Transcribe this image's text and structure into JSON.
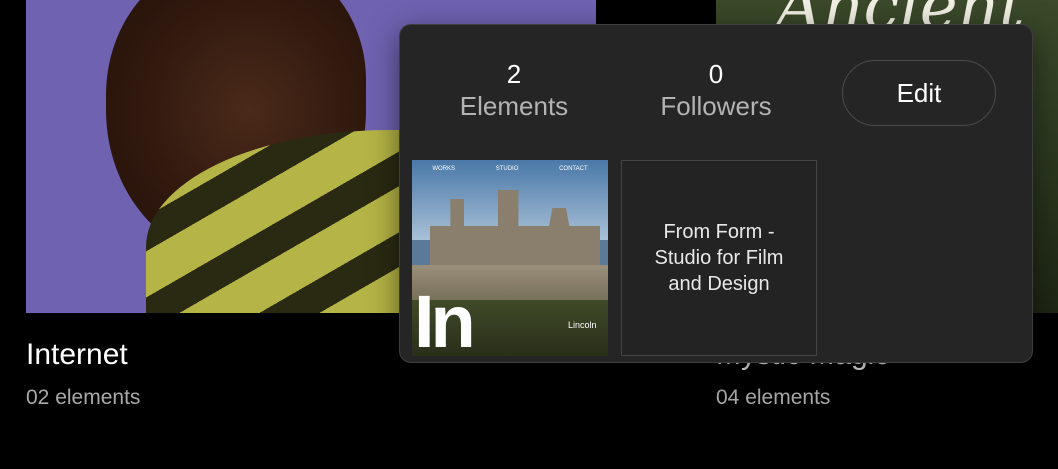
{
  "collections": [
    {
      "title": "Internet",
      "count": "02 elements"
    },
    {
      "title": "Mystic Magic",
      "count": "04 elements",
      "cover_text": "Ancient"
    }
  ],
  "popover": {
    "stats": [
      {
        "value": "2",
        "label": "Elements"
      },
      {
        "value": "0",
        "label": "Followers"
      }
    ],
    "edit_label": "Edit",
    "thumbnails": [
      {
        "type": "image",
        "logo_text": "In",
        "nav": [
          "WORKS",
          "STUDIO",
          "CONTACT"
        ],
        "caption": "Lincoln"
      },
      {
        "type": "text",
        "text": "From Form - Studio for Film and Design"
      }
    ]
  }
}
